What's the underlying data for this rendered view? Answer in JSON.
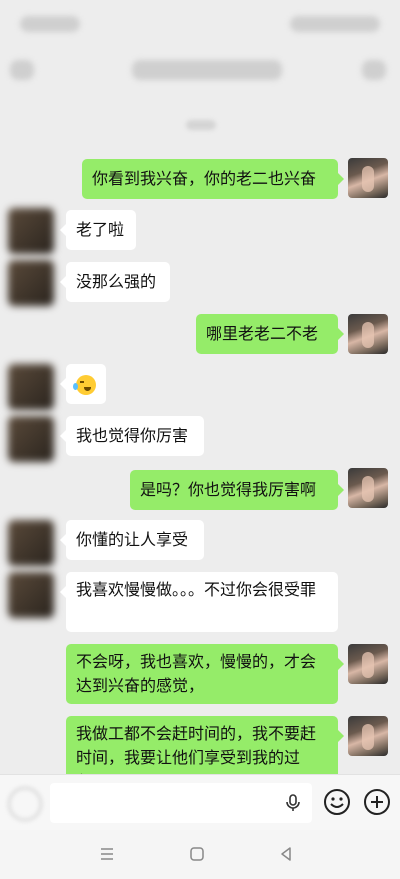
{
  "status_bar": {
    "time": "",
    "indicators": ""
  },
  "header": {
    "title": ""
  },
  "messages": [
    {
      "side": "right",
      "text": "你看到我兴奋，你的老二也兴奋"
    },
    {
      "side": "left",
      "text": "老了啦"
    },
    {
      "side": "left",
      "text": "没那么强的"
    },
    {
      "side": "right",
      "text": "哪里老老二不老"
    },
    {
      "side": "left",
      "text": "",
      "emoji": "crying-laughing-emoji"
    },
    {
      "side": "left",
      "text": "我也觉得你厉害"
    },
    {
      "side": "right",
      "text": "是吗？你也觉得我厉害啊"
    },
    {
      "side": "left",
      "text": "你懂的让人享受"
    },
    {
      "side": "left",
      "text": "我喜欢慢慢做。。。不过你会很受罪"
    },
    {
      "side": "right",
      "text": "不会呀，我也喜欢，慢慢的，才会达到兴奋的感觉，"
    },
    {
      "side": "right",
      "text": "我做工都不会赶时间的，我不要赶时间，我要让他们享受到我的过程，"
    }
  ],
  "colors": {
    "background": "#ededed",
    "outgoing_bubble": "#95ec69",
    "incoming_bubble": "#ffffff"
  },
  "icons": {
    "voice": "voice-icon",
    "emoji": "emoji-icon",
    "more": "plus-circle-icon",
    "mic": "mic-icon"
  }
}
